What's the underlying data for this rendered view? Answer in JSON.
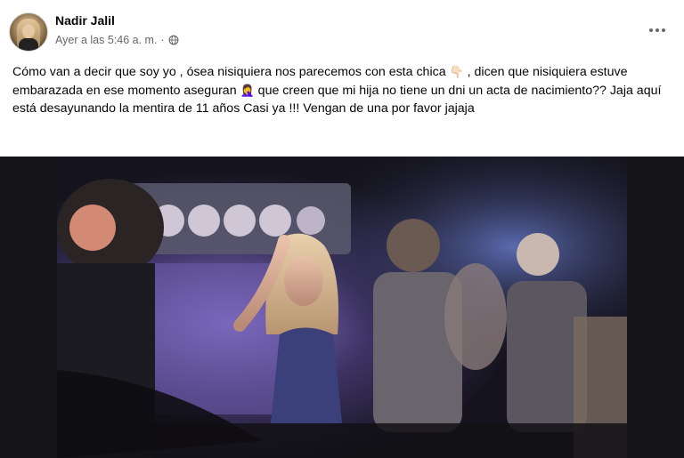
{
  "post": {
    "author": "Nadir Jalil",
    "timestamp": "Ayer a las 5:46 a. m.",
    "separator": "·",
    "privacy_icon": "globe-icon",
    "more_icon": "more-horizontal-icon",
    "text_part1": "Cómo van a decir que soy yo , ósea nisiquiera nos parecemos con esta chica ",
    "emoji1": "👇🏻",
    "text_part2": " , dicen que nisiquiera estuve embarazada en ese momento aseguran ",
    "emoji2": "🤦‍♀️",
    "text_part3": " que creen que mi hija no tiene un dni un acta de nacimiento?? Jaja aquí está desayunando la mentira de 11 años Casi ya !!! Vengan de una por favor jajaja"
  },
  "colors": {
    "primary_text": "#050505",
    "secondary_text": "#65676b",
    "video_bg": "#141418"
  }
}
